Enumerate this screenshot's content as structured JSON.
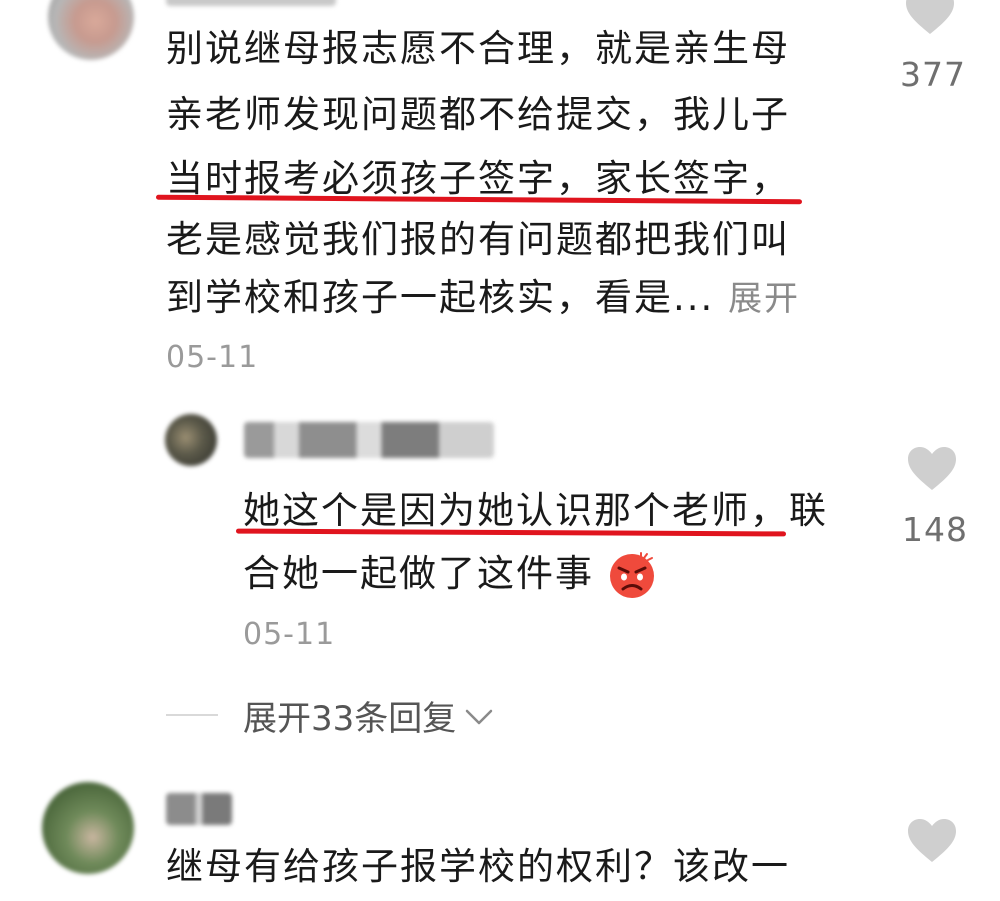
{
  "comments": [
    {
      "lines": [
        "别说继母报志愿不合理，就是亲生母",
        "亲老师发现问题都不给提交，我儿子",
        "当时报考必须孩子签字，家长签字，",
        "老是感觉我们报的有问题都把我们叫",
        "到学校和孩子一起核实，看是..."
      ],
      "expand_label": "展开",
      "date": "05-11",
      "likes": "377"
    },
    {
      "lines": [
        "她这个是因为她认识那个老师，联",
        "合她一起做了这件事"
      ],
      "emoji": "angry-face-emoji",
      "date": "05-11",
      "likes": "148"
    },
    {
      "line": "继母有给孩子报学校的权利？该改一"
    }
  ],
  "replies_toggle": "展开33条回复",
  "colors": {
    "underline": "#e0141e",
    "muted": "#9a9a9a",
    "heart": "#cfcfcf"
  }
}
